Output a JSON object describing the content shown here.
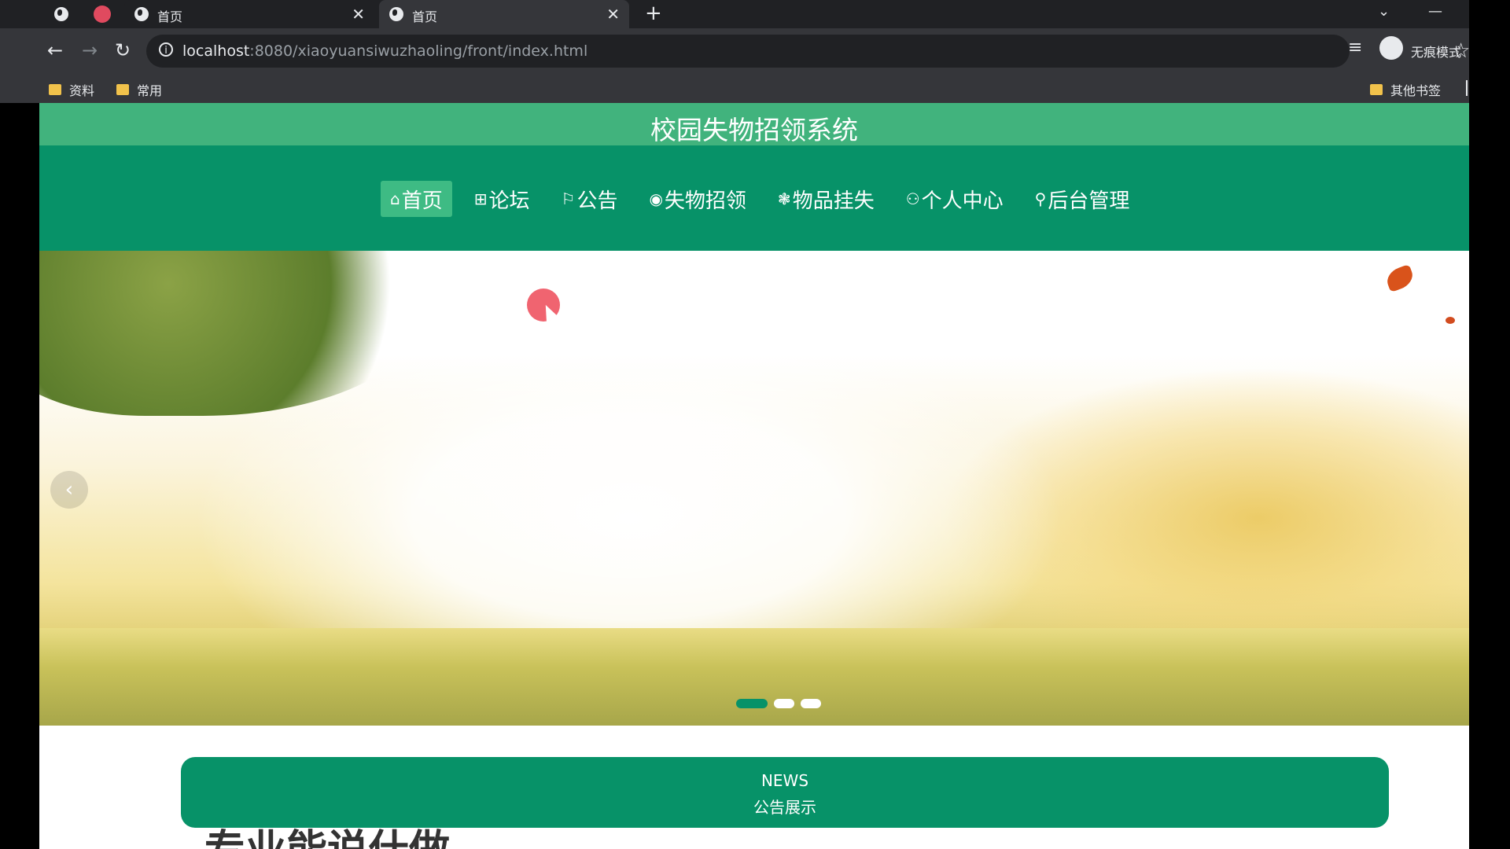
{
  "browser": {
    "tabs": [
      {
        "title": "首页",
        "active": false
      },
      {
        "title": "首页",
        "active": true
      }
    ],
    "new_tab_symbol": "+",
    "close_symbol": "✕",
    "url_host": "localhost",
    "url_rest": ":8080/xiaoyuansiwuzhaoling/front/index.html",
    "incognito_label": "无痕模式",
    "bookmarks": [
      "资料",
      "常用"
    ],
    "other_bookmarks": "其他书签"
  },
  "site": {
    "title": "校园失物招领系统",
    "nav": [
      {
        "icon": "⌂",
        "label": "首页",
        "active": true
      },
      {
        "icon": "⊞",
        "label": "论坛",
        "active": false
      },
      {
        "icon": "⚐",
        "label": "公告",
        "active": false
      },
      {
        "icon": "◉",
        "label": "失物招领",
        "active": false
      },
      {
        "icon": "❃",
        "label": "物品挂失",
        "active": false
      },
      {
        "icon": "⚇",
        "label": "个人中心",
        "active": false
      },
      {
        "icon": "⚲",
        "label": "后台管理",
        "active": false
      }
    ]
  },
  "carousel": {
    "prev_symbol": "‹",
    "active_index": 0,
    "slide_count": 3
  },
  "news": {
    "label_en": "NEWS",
    "label_cn": "公告展示"
  },
  "partial_heading": "专业能说什做"
}
